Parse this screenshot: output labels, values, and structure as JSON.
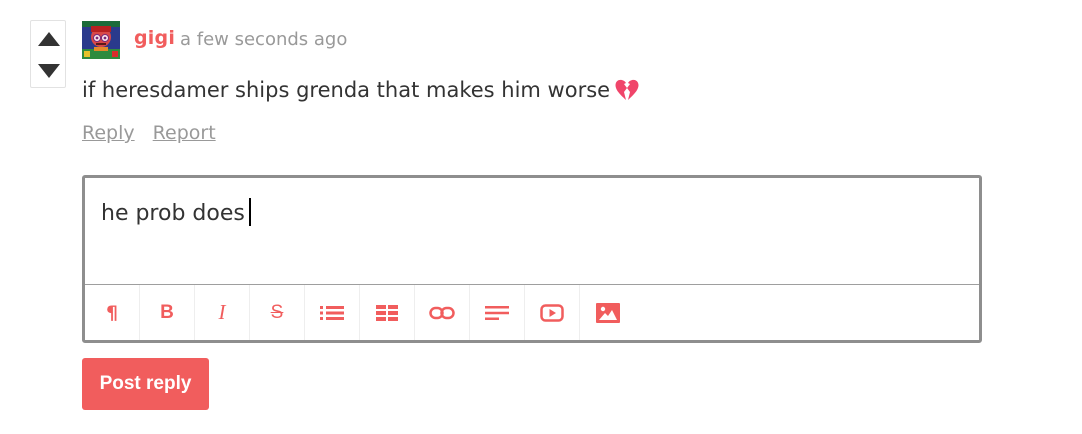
{
  "comment": {
    "username": "gigi",
    "timestamp": "a few seconds ago",
    "text": "if heresdamer ships grenda that makes him worse",
    "emoji_icon": "broken-heart-icon",
    "actions": {
      "reply_label": "Reply",
      "report_label": "Report"
    },
    "vote": {
      "up_icon": "upvote-arrow-icon",
      "down_icon": "downvote-arrow-icon"
    }
  },
  "editor": {
    "value": "he prob does",
    "toolbar": [
      {
        "name": "paragraph-icon"
      },
      {
        "name": "bold-icon"
      },
      {
        "name": "italic-icon"
      },
      {
        "name": "strikethrough-icon"
      },
      {
        "name": "bullet-list-icon"
      },
      {
        "name": "table-icon"
      },
      {
        "name": "link-icon"
      },
      {
        "name": "align-left-icon"
      },
      {
        "name": "video-icon"
      },
      {
        "name": "image-icon"
      }
    ]
  },
  "submit": {
    "label": "Post reply"
  },
  "colors": {
    "accent": "#f15d5d",
    "muted_text": "#999999",
    "body_text": "#333333",
    "editor_border": "#8e8e8e"
  }
}
